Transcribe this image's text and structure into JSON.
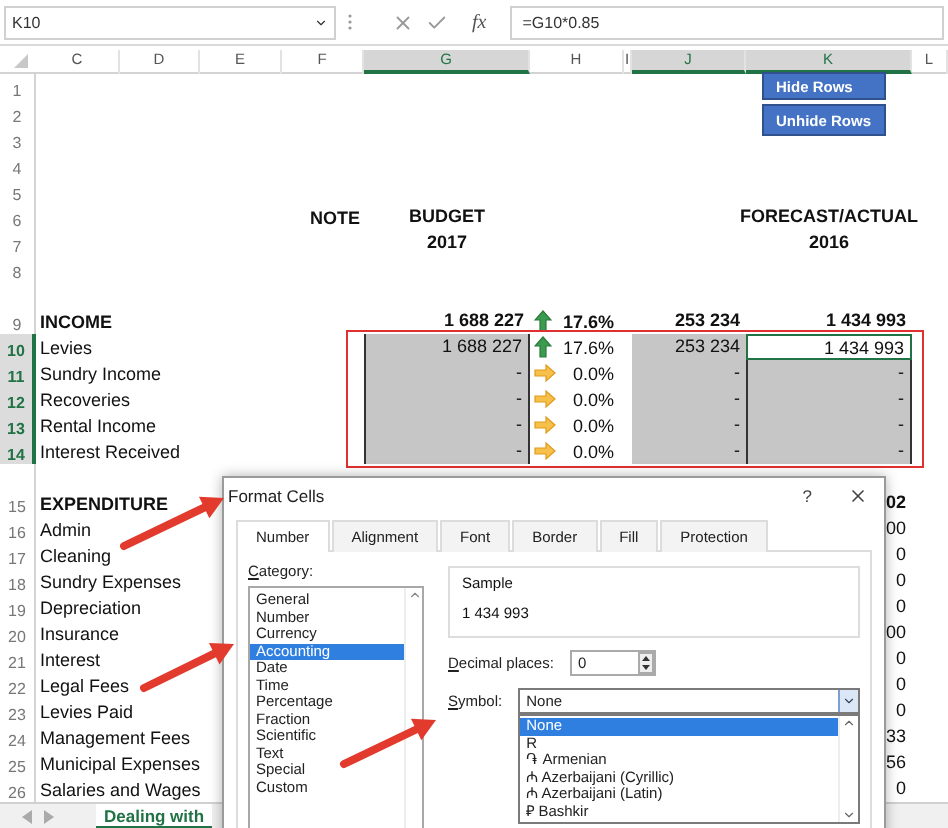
{
  "formula_bar": {
    "name_box": "K10",
    "fx": "fx",
    "formula": "=G10*0.85"
  },
  "columns": [
    {
      "label": "C",
      "selected": false
    },
    {
      "label": "D",
      "selected": false
    },
    {
      "label": "E",
      "selected": false
    },
    {
      "label": "F",
      "selected": false
    },
    {
      "label": "G",
      "selected": true
    },
    {
      "label": "H",
      "selected": false
    },
    {
      "label": "I",
      "selected": false
    },
    {
      "label": "J",
      "selected": true
    },
    {
      "label": "K",
      "selected": true
    },
    {
      "label": "L",
      "selected": false
    }
  ],
  "buttons": [
    "Hide Rows",
    "Unhide Rows"
  ],
  "rows": [
    {
      "number": "1",
      "selected": false
    },
    {
      "number": "2",
      "selected": false
    },
    {
      "number": "3",
      "selected": false
    },
    {
      "number": "4",
      "selected": false
    },
    {
      "number": "5",
      "selected": false
    },
    {
      "number": "6",
      "selected": false,
      "bold": true,
      "note": "NOTE",
      "budget": "BUDGET",
      "forecast": "FORECAST/ACTUAL"
    },
    {
      "number": "7",
      "selected": false,
      "bold": true,
      "budget": "2017",
      "forecast": "2016"
    },
    {
      "number": "8",
      "selected": false
    },
    {
      "number": "9",
      "selected": false,
      "bold": true,
      "tall": true,
      "label": "INCOME",
      "budget": "1 688 227",
      "kind": "up",
      "change": "17.6%",
      "variance": "253 234",
      "forecast": "1 434 993"
    },
    {
      "number": "10",
      "selected": true,
      "shaded": true,
      "active": true,
      "label": "Levies",
      "budget": "1 688 227",
      "kind": "up",
      "change": "17.6%",
      "variance": "253 234",
      "forecast": "1 434 993"
    },
    {
      "number": "11",
      "selected": true,
      "shaded": true,
      "active": false,
      "label": "Sundry Income",
      "budget": "-",
      "kind": "flat",
      "change": "0.0%",
      "variance": "-",
      "forecast": "-"
    },
    {
      "number": "12",
      "selected": true,
      "shaded": true,
      "active": false,
      "label": "Recoveries",
      "budget": "-",
      "kind": "flat",
      "change": "0.0%",
      "variance": "-",
      "forecast": "-"
    },
    {
      "number": "13",
      "selected": true,
      "shaded": true,
      "active": false,
      "label": "Rental Income",
      "budget": "-",
      "kind": "flat",
      "change": "0.0%",
      "variance": "-",
      "forecast": "-"
    },
    {
      "number": "14",
      "selected": true,
      "shaded": true,
      "active": false,
      "label": "Interest Received",
      "budget": "-",
      "kind": "flat",
      "change": "0.0%",
      "variance": "-",
      "forecast": "-"
    },
    {
      "number": "15",
      "selected": false,
      "bold": true,
      "tall": true,
      "label": "EXPENDITURE",
      "forecast": "02"
    },
    {
      "number": "16",
      "selected": false,
      "label": "Admin",
      "forecast": "00"
    },
    {
      "number": "17",
      "selected": false,
      "label": "Cleaning",
      "forecast": "0"
    },
    {
      "number": "18",
      "selected": false,
      "label": "Sundry Expenses",
      "forecast": "0"
    },
    {
      "number": "19",
      "selected": false,
      "label": "Depreciation",
      "forecast": "0"
    },
    {
      "number": "20",
      "selected": false,
      "label": "Insurance",
      "forecast": "00"
    },
    {
      "number": "21",
      "selected": false,
      "label": "Interest",
      "forecast": "0"
    },
    {
      "number": "22",
      "selected": false,
      "label": "Legal Fees",
      "forecast": "0"
    },
    {
      "number": "23",
      "selected": false,
      "label": "Levies Paid",
      "forecast": "0"
    },
    {
      "number": "24",
      "selected": false,
      "label": "Management Fees",
      "forecast": "33"
    },
    {
      "number": "25",
      "selected": false,
      "label": "Municipal Expenses",
      "forecast": "56"
    },
    {
      "number": "26",
      "selected": false,
      "label": "Salaries and Wages",
      "forecast": "0"
    }
  ],
  "sheet_tabs": [
    {
      "label": "Dealing with",
      "selected": true
    }
  ],
  "dialog": {
    "title": "Format Cells",
    "help": "?",
    "tabs": [
      {
        "label": "Number",
        "selected": true
      },
      {
        "label": "Alignment",
        "selected": false
      },
      {
        "label": "Font",
        "selected": false
      },
      {
        "label": "Border",
        "selected": false
      },
      {
        "label": "Fill",
        "selected": false
      },
      {
        "label": "Protection",
        "selected": false
      }
    ],
    "category_label": "Category:",
    "categories": [
      {
        "label": "General",
        "selected": false
      },
      {
        "label": "Number",
        "selected": false
      },
      {
        "label": "Currency",
        "selected": false
      },
      {
        "label": "Accounting",
        "selected": true
      },
      {
        "label": "Date",
        "selected": false
      },
      {
        "label": "Time",
        "selected": false
      },
      {
        "label": "Percentage",
        "selected": false
      },
      {
        "label": "Fraction",
        "selected": false
      },
      {
        "label": "Scientific",
        "selected": false
      },
      {
        "label": "Text",
        "selected": false
      },
      {
        "label": "Special",
        "selected": false
      },
      {
        "label": "Custom",
        "selected": false
      }
    ],
    "sample_label": "Sample",
    "sample": "1 434 993",
    "decimal_label": "Decimal places:",
    "decimal_value": "0",
    "symbol_label": "Symbol:",
    "symbol_value": "None",
    "symbol_options": [
      {
        "label": "None",
        "selected": true
      },
      {
        "label": "R",
        "selected": false
      },
      {
        "label": "֏ Armenian",
        "selected": false
      },
      {
        "label": "₼ Azerbaijani (Cyrillic)",
        "selected": false
      },
      {
        "label": "₼ Azerbaijani (Latin)",
        "selected": false
      },
      {
        "label": "₽ Bashkir",
        "selected": false
      }
    ]
  }
}
